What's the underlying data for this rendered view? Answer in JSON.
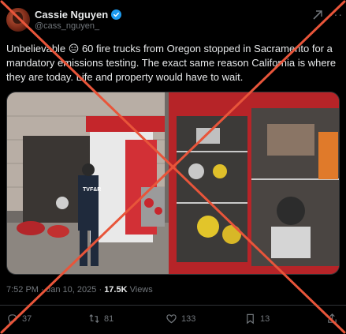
{
  "author": {
    "display_name": "Cassie Nguyen",
    "handle": "@cass_nguyen_",
    "verified": true
  },
  "tweet": {
    "text": "Unbelievable 😑 60 fire trucks from Oregon stopped in Sacramento for a mandatory emissions testing. The exact same reason California is where they are today. Life and property would have to wait."
  },
  "media": {
    "description_kind": "video-thumbnail",
    "truck_label": "TVF&R"
  },
  "meta": {
    "time": "7:52 PM",
    "separator": "·",
    "date": "Jan 10, 2025",
    "views_count": "17.5K",
    "views_label": "Views"
  },
  "actions": {
    "replies": "37",
    "reposts": "81",
    "likes": "133",
    "bookmarks": "13"
  },
  "colors": {
    "background": "#000000",
    "text": "#e7e9ea",
    "muted": "#71767b",
    "verified": "#1d9bf0",
    "overlay_cross": "#e8553a"
  }
}
